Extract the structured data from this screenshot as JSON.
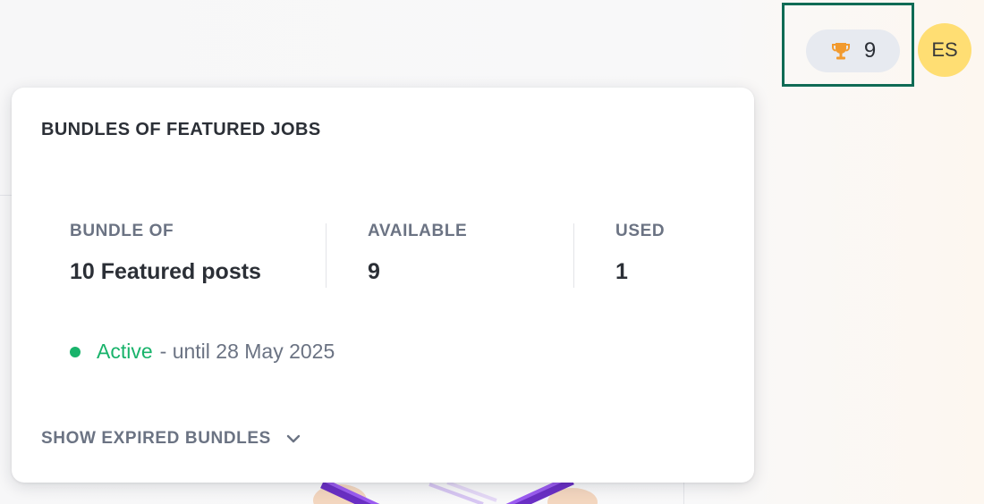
{
  "header": {
    "credits_count": "9",
    "avatar_initials": "ES"
  },
  "popover": {
    "title": "BUNDLES OF FEATURED JOBS",
    "stats": [
      {
        "label": "BUNDLE OF",
        "value": "10 Featured posts"
      },
      {
        "label": "AVAILABLE",
        "value": "9"
      },
      {
        "label": "USED",
        "value": "1"
      }
    ],
    "status": {
      "state": "Active",
      "until": "- until 28 May 2025"
    },
    "show_expired_label": "SHOW EXPIRED BUNDLES"
  },
  "colors": {
    "highlight_border": "#0f6b55",
    "pill_background": "#e7eaf0",
    "trophy": "#f29a2e",
    "avatar_background": "#ffde73",
    "active_green": "#19b36b"
  },
  "icons": {
    "trophy": "trophy-icon",
    "chevron": "chevron-down-icon"
  }
}
